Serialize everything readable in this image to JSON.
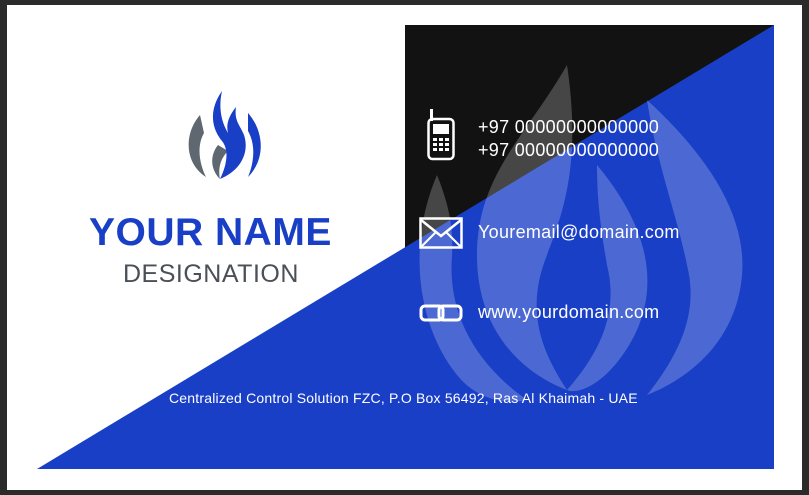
{
  "card": {
    "name": "YOUR NAME",
    "designation": "DESIGNATION",
    "phone_1": "+97 00000000000000",
    "phone_2": "+97 00000000000000",
    "email": "Youremail@domain.com",
    "website": "www.yourdomain.com",
    "address": "Centralized Control Solution FZC,  P.O Box 56492,  Ras Al Khaimah - UAE"
  },
  "icons": {
    "logo": "flame-logo",
    "phone": "mobile-phone-icon",
    "email": "envelope-icon",
    "website": "chain-link-icon"
  },
  "colors": {
    "brand_blue": "#1a3fc7",
    "panel_black": "#121212",
    "card_white": "#ffffff",
    "logo_gray": "#5f6770",
    "frame": "#2b2b2b"
  }
}
